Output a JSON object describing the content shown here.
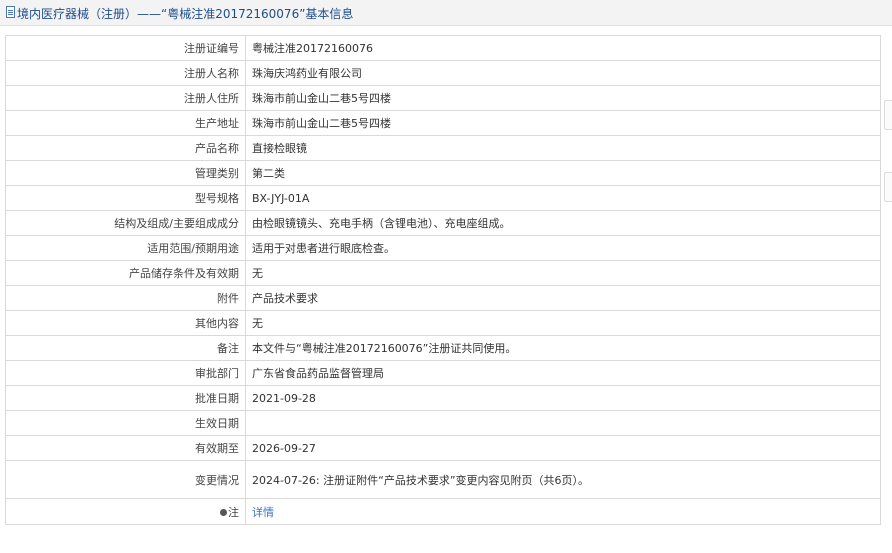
{
  "header": {
    "title": "境内医疗器械（注册）——“粤械注准20172160076”基本信息"
  },
  "rows": [
    {
      "label": "注册证编号",
      "value": "粤械注准20172160076"
    },
    {
      "label": "注册人名称",
      "value": "珠海庆鸿药业有限公司"
    },
    {
      "label": "注册人住所",
      "value": "珠海市前山金山二巷5号四楼"
    },
    {
      "label": "生产地址",
      "value": "珠海市前山金山二巷5号四楼"
    },
    {
      "label": "产品名称",
      "value": "直接检眼镜"
    },
    {
      "label": "管理类别",
      "value": "第二类"
    },
    {
      "label": "型号规格",
      "value": "BX-JYJ-01A"
    },
    {
      "label": "结构及组成/主要组成成分",
      "value": "由检眼镜镜头、充电手柄（含锂电池）、充电座组成。"
    },
    {
      "label": "适用范围/预期用途",
      "value": "适用于对患者进行眼底检查。"
    },
    {
      "label": "产品储存条件及有效期",
      "value": "无"
    },
    {
      "label": "附件",
      "value": "产品技术要求"
    },
    {
      "label": "其他内容",
      "value": "无"
    },
    {
      "label": "备注",
      "value": "本文件与“粤械注准20172160076”注册证共同使用。"
    },
    {
      "label": "审批部门",
      "value": "广东省食品药品监督管理局"
    },
    {
      "label": "批准日期",
      "value": "2021-09-28"
    },
    {
      "label": "生效日期",
      "value": ""
    },
    {
      "label": "有效期至",
      "value": "2026-09-27"
    },
    {
      "label": "变更情况",
      "value": "2024-07-26: 注册证附件“产品技术要求”变更内容见附页（共6页）。"
    }
  ],
  "note": {
    "label": "注",
    "icon": "pin-icon",
    "link_text": "详情"
  }
}
